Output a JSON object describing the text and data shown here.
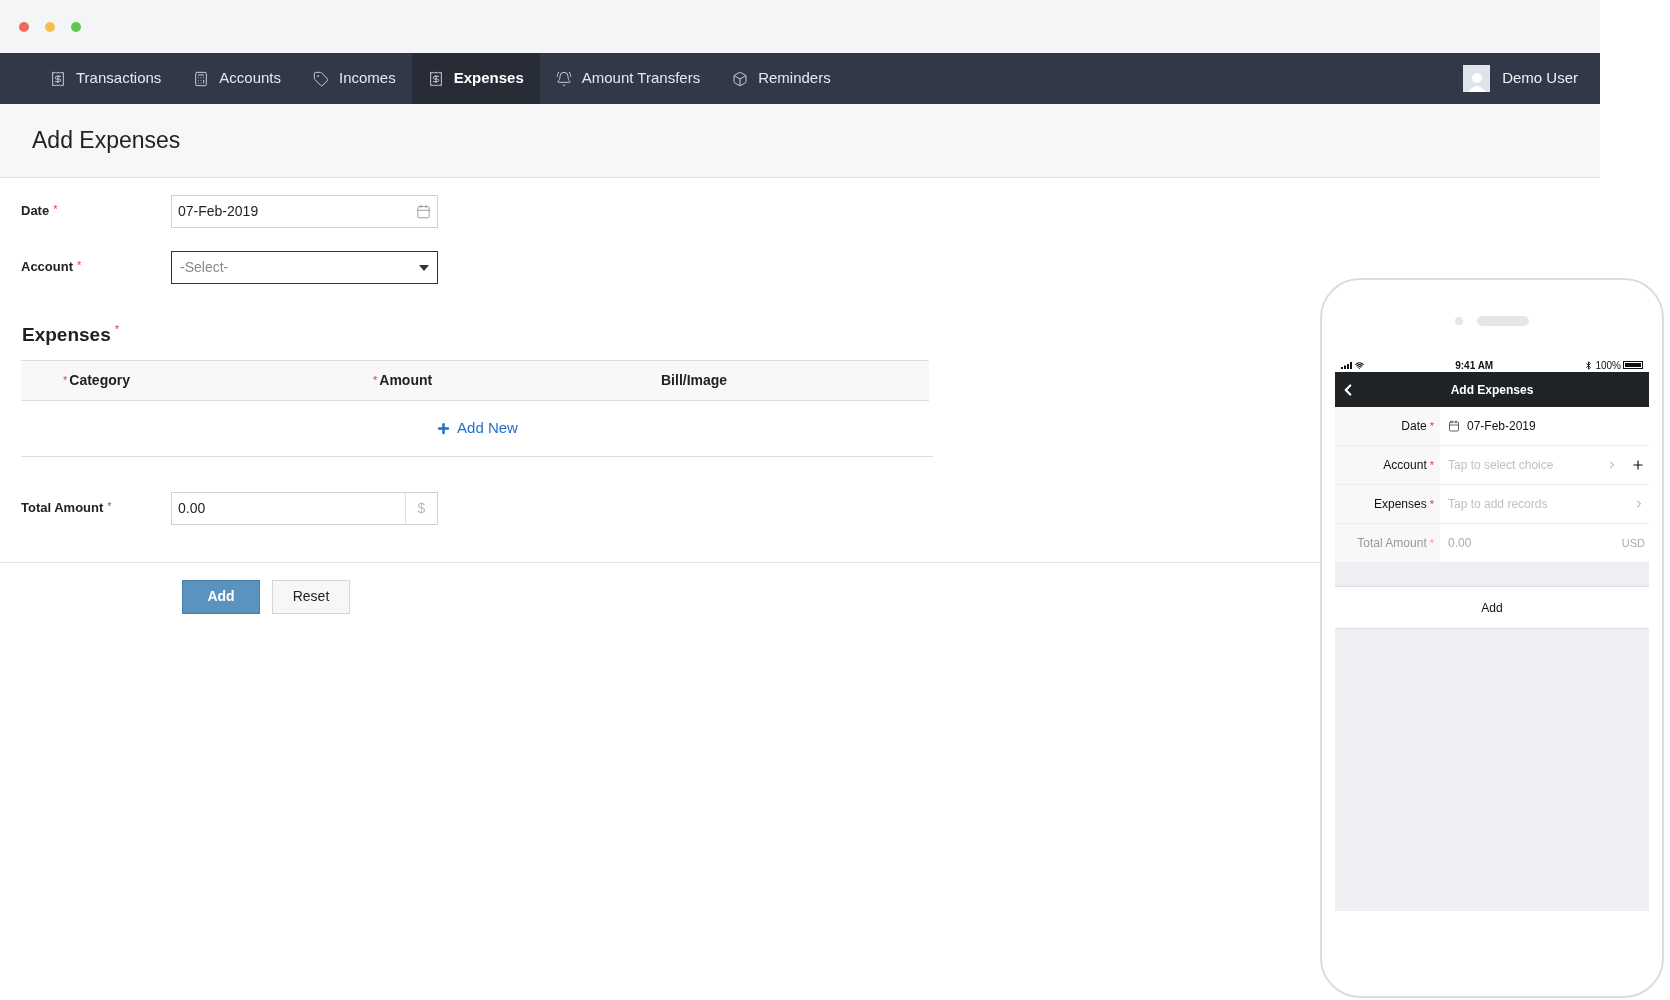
{
  "nav": {
    "items": [
      {
        "label": "Transactions",
        "kind": "receipt",
        "selected": false
      },
      {
        "label": "Accounts",
        "kind": "calculator",
        "selected": false
      },
      {
        "label": "Incomes",
        "kind": "tag",
        "selected": false
      },
      {
        "label": "Expenses",
        "kind": "receipt",
        "selected": true
      },
      {
        "label": "Amount Transfers",
        "kind": "bell",
        "selected": false
      },
      {
        "label": "Reminders",
        "kind": "cube",
        "selected": false
      }
    ],
    "user": "Demo User"
  },
  "page_title": "Add Expenses",
  "form": {
    "date": {
      "label": "Date",
      "mark": "*",
      "value": "07-Feb-2019"
    },
    "account": {
      "label": "Account",
      "mark": "*",
      "placeholder": "-Select-"
    },
    "expenses": {
      "title": "Expenses",
      "mark": "*",
      "columns": [
        {
          "label": "Category",
          "mark": "*"
        },
        {
          "label": "Amount",
          "mark": "*"
        },
        {
          "label": "Bill/Image"
        }
      ],
      "add_new": "Add New"
    },
    "total": {
      "label": "Total Amount",
      "mark": "*",
      "value": "0.00",
      "currency": "$"
    },
    "buttons": [
      {
        "label": "Add",
        "kind": "primary"
      },
      {
        "label": "Reset",
        "kind": "secondary"
      }
    ]
  },
  "phone": {
    "status": {
      "time": "9:41 AM",
      "battery": "100%"
    },
    "title": "Add Expenses",
    "rows": [
      {
        "label": "Date",
        "mark": "*",
        "kind": "date",
        "value": "07-Feb-2019",
        "disabled": false
      },
      {
        "label": "Account",
        "mark": "*",
        "kind": "choice",
        "placeholder": "Tap to select choice",
        "disabled": false
      },
      {
        "label": "Expenses",
        "mark": "*",
        "kind": "records",
        "placeholder": "Tap to add records",
        "disabled": false
      },
      {
        "label": "Total Amount",
        "mark": "*",
        "kind": "amount",
        "placeholder": "0.00",
        "suffix": "USD",
        "disabled": true
      }
    ],
    "button": "Add"
  }
}
